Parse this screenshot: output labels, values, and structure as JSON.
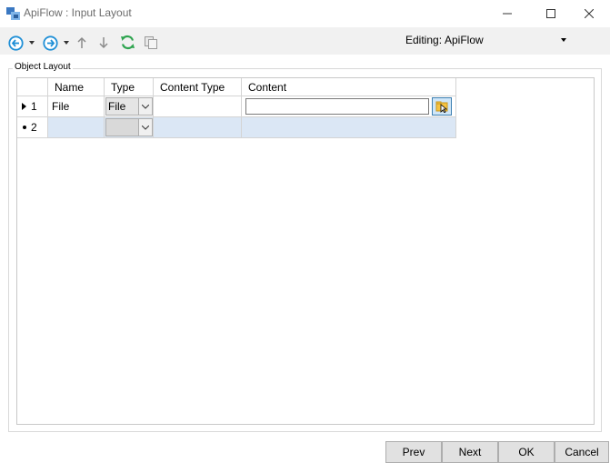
{
  "window": {
    "title": "ApiFlow : Input Layout",
    "controls": {
      "minimize": "minimize-icon",
      "maximize": "maximize-icon",
      "close": "close-icon"
    }
  },
  "toolbar": {
    "icons": [
      "back-circle-icon",
      "forward-circle-icon",
      "arrow-up-icon",
      "arrow-down-icon",
      "refresh-icon",
      "copy-icon"
    ],
    "editing_label": "Editing:",
    "editing_value": "ApiFlow"
  },
  "group": {
    "label": "Object Layout"
  },
  "grid": {
    "columns": [
      "Name",
      "Type",
      "Content Type",
      "Content"
    ],
    "rows": [
      {
        "num": "1",
        "name": "File",
        "type": "File",
        "content_type": "",
        "content": ""
      },
      {
        "num": "2",
        "name": "",
        "type": "",
        "content_type": "",
        "content": ""
      }
    ]
  },
  "buttons": {
    "prev": "Prev",
    "next": "Next",
    "ok": "OK",
    "cancel": "Cancel"
  },
  "colors": {
    "accent": "#1f8fd6",
    "selection": "#dbe7f5",
    "refresh": "#2ea44f",
    "folder": "#f5c342"
  }
}
